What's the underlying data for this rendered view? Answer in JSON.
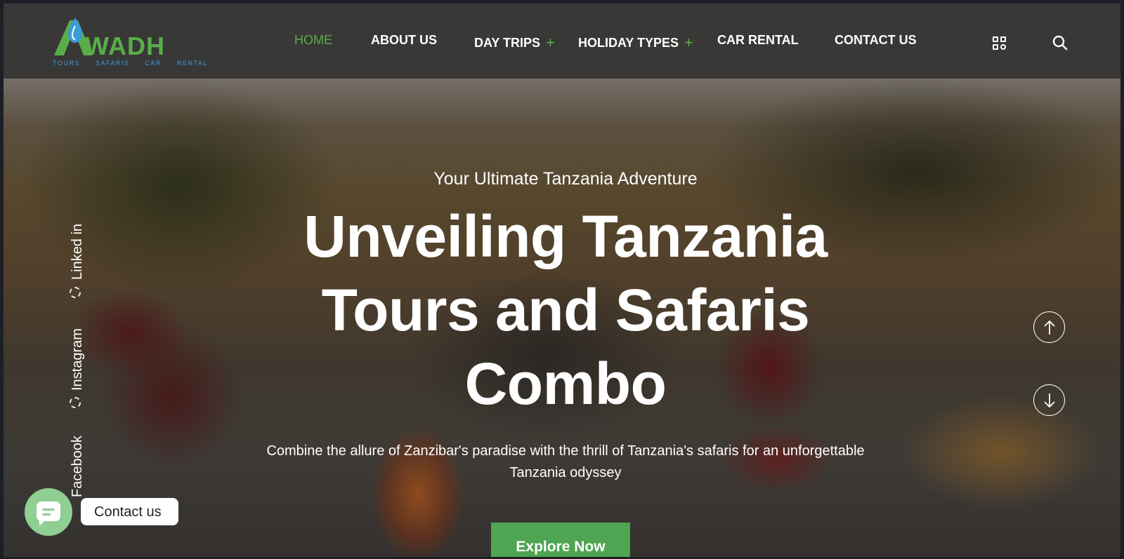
{
  "colors": {
    "accent_green": "#4fa551",
    "nav_active": "#5aad49",
    "header_bg": "#303030",
    "logo_blue": "#3b9bd8",
    "chat_green": "#8fcf92"
  },
  "logo": {
    "word": "WADH",
    "tagline": "TOURS SAFARIS CAR RENTAL",
    "icon": "awadh-logo-icon"
  },
  "nav": {
    "items": [
      {
        "label": "HOME",
        "active": true
      },
      {
        "label": "ABOUT US"
      },
      {
        "label": "DAY TRIPS",
        "expand": "+"
      },
      {
        "label": "HOLIDAY TYPES",
        "expand": "+"
      },
      {
        "label": "CAR RENTAL"
      },
      {
        "label": "CONTACT US"
      }
    ],
    "icons": [
      "grid-menu-icon",
      "search-icon"
    ]
  },
  "hero": {
    "subtitle": "Your Ultimate Tanzania Adventure",
    "title": "Unveiling Tanzania Tours and Safaris Combo",
    "description": "Combine the allure of Zanzibar's paradise with the thrill of Tanzania's safaris for an unforgettable Tanzania odyssey",
    "cta_label": "Explore Now"
  },
  "social": {
    "links": [
      {
        "label": "Linked in",
        "icon": "dot-icon"
      },
      {
        "label": "Instagram",
        "icon": "dot-icon"
      },
      {
        "label": "Facebook",
        "icon": "dot-icon"
      }
    ]
  },
  "slider": {
    "up_icon": "arrow-up-icon",
    "down_icon": "arrow-down-icon"
  },
  "contact_widget": {
    "label": "Contact us",
    "icon": "chat-icon"
  }
}
